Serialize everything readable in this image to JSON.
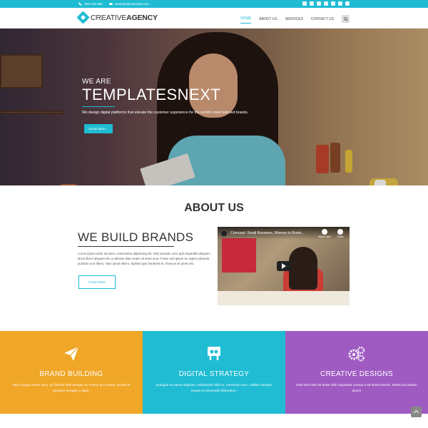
{
  "topbar": {
    "phone": "000-123-456",
    "email": "example@example.com",
    "social_icons": [
      "twitter-icon",
      "facebook-icon",
      "linkedin-icon",
      "flickr-icon",
      "vimeo-icon",
      "youtube-icon",
      "instagram-icon"
    ]
  },
  "brand": {
    "logo_light": "CREATIVE",
    "logo_bold": "AGENCY"
  },
  "nav": {
    "items": [
      {
        "label": "HOME"
      },
      {
        "label": "ABOUT US"
      },
      {
        "label": "SERVICES"
      },
      {
        "label": "CONTACT US"
      }
    ],
    "search_icon": "search-icon"
  },
  "hero": {
    "small": "WE ARE",
    "big": "TEMPLATESNEXT",
    "description": "We design digital platforms that elevate the customer experience for the world's most beloved brands.",
    "button": "Know More..."
  },
  "about": {
    "title": "ABOUT US",
    "heading": "WE BUILD BRANDS",
    "body": "Lorem ipsum dolor sit amet, consectetur adipiscing elit. Sed suscipit, nunc quis imperdiet aliquam, lacus libero aliquam elit, a ultricies diam turpis sit amet urna. Fusce sed ipsum ac sapien placerat pulvinar ut at libero. Nam ipsum libero, facilisis quis hendrerit et, rhoncus sit amet nisi.",
    "button": "Know More"
  },
  "video": {
    "title": "Comcast: Small Business, Women in Busin...",
    "watch_later": "Watch later",
    "share": "Share"
  },
  "features": [
    {
      "icon": "paper-plane-icon",
      "title": "BRAND BUILDING",
      "desc": "Sed congue lorem arcu, ac finibus velit semper at. Fusce arcu tortor, iaculis et posuere semper a diam.",
      "color": "#f0a627"
    },
    {
      "icon": "slideshare-icon",
      "title": "DIGITAL STRATEGY",
      "desc": "Quisque eu lacus aliquam, sollicitudin nibh in, maximus nunc. Nullam tempor neque et venenatis bibendum.",
      "color": "#1fbcd3"
    },
    {
      "icon": "gears-icon",
      "title": "CREATIVE DESIGNS",
      "desc": "Duis sed odio sit amet nibh vulputate cursus a sit amet mauris. Morbi accumsan ipsum",
      "color": "#a05bc3"
    }
  ],
  "colors": {
    "accent": "#1fbcd3",
    "orange": "#f0a627",
    "purple": "#a05bc3"
  }
}
